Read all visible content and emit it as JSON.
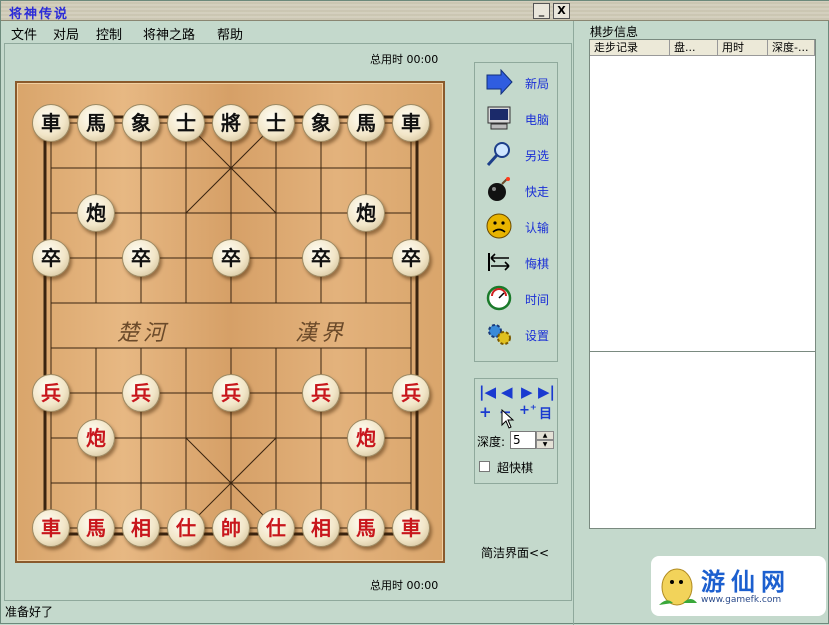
{
  "window": {
    "title": "将神传说",
    "minimize_label": "_",
    "close_label": "X"
  },
  "menu": [
    "文件",
    "对局",
    "控制",
    "将神之路",
    "帮助"
  ],
  "timers": {
    "top": "总用时  00:00",
    "bottom": "总用时  00:00"
  },
  "board": {
    "river_left": "楚河",
    "river_right": "漢界",
    "pieces": {
      "black_back": [
        "車",
        "馬",
        "象",
        "士",
        "將",
        "士",
        "象",
        "馬",
        "車"
      ],
      "black_cannon": [
        "炮",
        "炮"
      ],
      "black_soldier": [
        "卒",
        "卒",
        "卒",
        "卒",
        "卒"
      ],
      "red_soldier": [
        "兵",
        "兵",
        "兵",
        "兵",
        "兵"
      ],
      "red_cannon": [
        "炮",
        "炮"
      ],
      "red_back": [
        "車",
        "馬",
        "相",
        "仕",
        "帥",
        "仕",
        "相",
        "馬",
        "車"
      ]
    },
    "colors": {
      "red": "#c8161c",
      "black": "#111111",
      "wood": "#dcaa70"
    }
  },
  "tools": [
    {
      "label": "新局",
      "icon": "arrow-icon"
    },
    {
      "label": "电脑",
      "icon": "computer-icon"
    },
    {
      "label": "另选",
      "icon": "magnifier-icon"
    },
    {
      "label": "快走",
      "icon": "bomb-icon"
    },
    {
      "label": "认输",
      "icon": "sad-face-icon"
    },
    {
      "label": "悔棋",
      "icon": "undo-arrows-icon"
    },
    {
      "label": "时间",
      "icon": "gauge-icon"
    },
    {
      "label": "设置",
      "icon": "gears-icon"
    }
  ],
  "nav": {
    "depth_label": "深度:",
    "depth_value": "5",
    "fast_label": "超快棋"
  },
  "simple_mode": "简洁界面<<",
  "info": {
    "title": "棋步信息",
    "columns": [
      "走步记录",
      "盘...",
      "用时",
      "深度-..."
    ]
  },
  "logo": {
    "text": "游仙网",
    "url": "www.gamefk.com"
  },
  "status": "准备好了"
}
